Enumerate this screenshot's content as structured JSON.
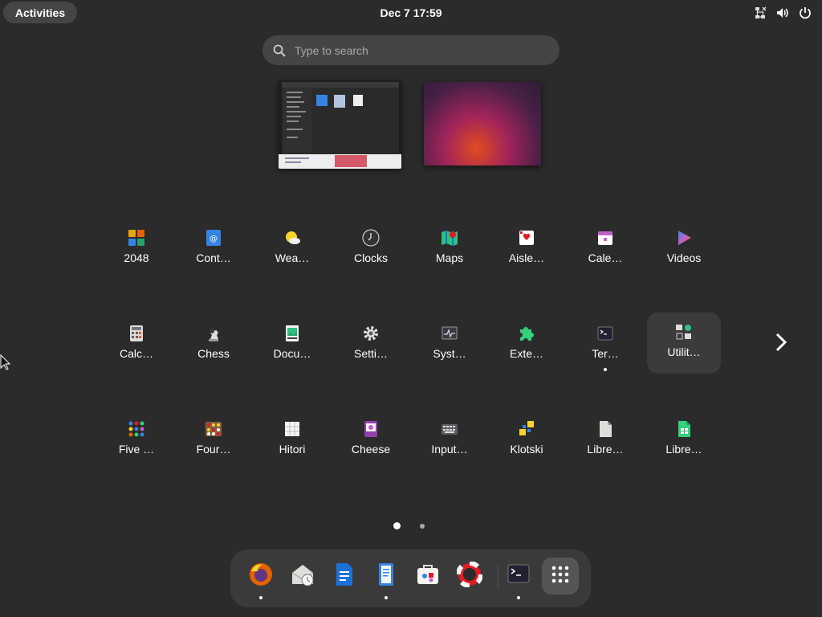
{
  "topbar": {
    "activities_label": "Activities",
    "clock": "Dec 7  17:59",
    "tray_icons": [
      "network-icon",
      "volume-icon",
      "power-icon"
    ]
  },
  "search": {
    "placeholder": "Type to search"
  },
  "workspaces": [
    "workspace-1-thumbnail",
    "workspace-2-thumbnail"
  ],
  "app_grid": {
    "row1": [
      {
        "label": "2048",
        "icon": "2048-icon"
      },
      {
        "label": "Cont…",
        "icon": "contacts-icon"
      },
      {
        "label": "Wea…",
        "icon": "weather-icon"
      },
      {
        "label": "Clocks",
        "icon": "clocks-icon"
      },
      {
        "label": "Maps",
        "icon": "maps-icon"
      },
      {
        "label": "Aisle…",
        "icon": "aisleriot-icon"
      },
      {
        "label": "Cale…",
        "icon": "calendar-icon"
      },
      {
        "label": "Videos",
        "icon": "videos-icon"
      }
    ],
    "row2": [
      {
        "label": "Calc…",
        "icon": "calculator-icon"
      },
      {
        "label": "Chess",
        "icon": "chess-icon"
      },
      {
        "label": "Docu…",
        "icon": "document-viewer-icon"
      },
      {
        "label": "Setti…",
        "icon": "settings-icon"
      },
      {
        "label": "Syst…",
        "icon": "system-monitor-icon"
      },
      {
        "label": "Exte…",
        "icon": "extensions-icon"
      },
      {
        "label": "Ter…",
        "icon": "terminal-icon"
      },
      {
        "label": "Utilit…",
        "icon": "utilities-folder-icon"
      }
    ],
    "row3": [
      {
        "label": "Five …",
        "icon": "five-or-more-icon"
      },
      {
        "label": "Four…",
        "icon": "four-in-a-row-icon"
      },
      {
        "label": "Hitori",
        "icon": "hitori-icon"
      },
      {
        "label": "Cheese",
        "icon": "cheese-icon"
      },
      {
        "label": "Input…",
        "icon": "input-method-icon"
      },
      {
        "label": "Klotski",
        "icon": "klotski-icon"
      },
      {
        "label": "Libre…",
        "icon": "libreoffice-icon"
      },
      {
        "label": "Libre…",
        "icon": "libreoffice-calc-icon"
      }
    ]
  },
  "pager": {
    "pages": 2,
    "current": 1
  },
  "dash": {
    "items": [
      "firefox-icon",
      "evolution-icon",
      "libreoffice-writer-icon",
      "text-editor-icon",
      "software-icon",
      "help-icon",
      "terminal-icon",
      "show-apps-icon"
    ]
  },
  "colors": {
    "background": "#2b2b2b",
    "panel": "#454545",
    "dash": "#3a3a3a"
  }
}
